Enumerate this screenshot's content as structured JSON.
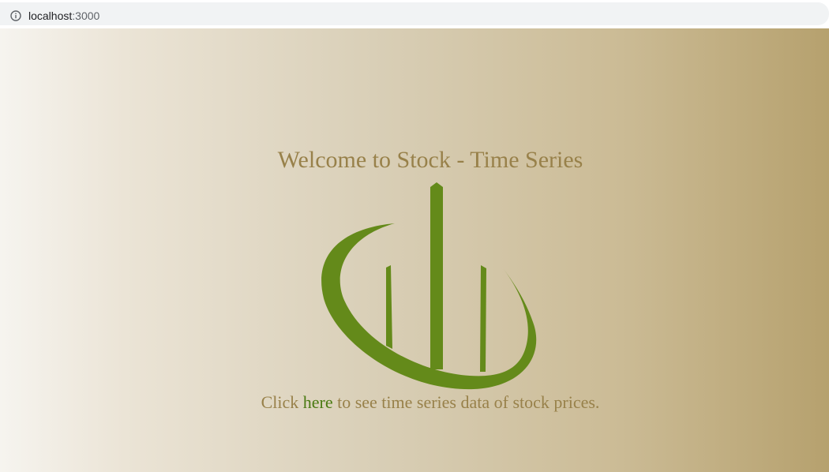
{
  "browser": {
    "url_host": "localhost",
    "url_port": ":3000"
  },
  "main": {
    "title": "Welcome to Stock - Time Series",
    "logo_icon": "stock-chart-logo-icon",
    "link_prefix": "Click ",
    "link_text": "here",
    "link_suffix": " to see time series data of stock prices."
  },
  "colors": {
    "title_text": "#98814a",
    "link": "#4a7a12",
    "logo_green": "#648a1a",
    "gradient_start": "#f6f4ef",
    "gradient_end": "#b6a16e"
  }
}
